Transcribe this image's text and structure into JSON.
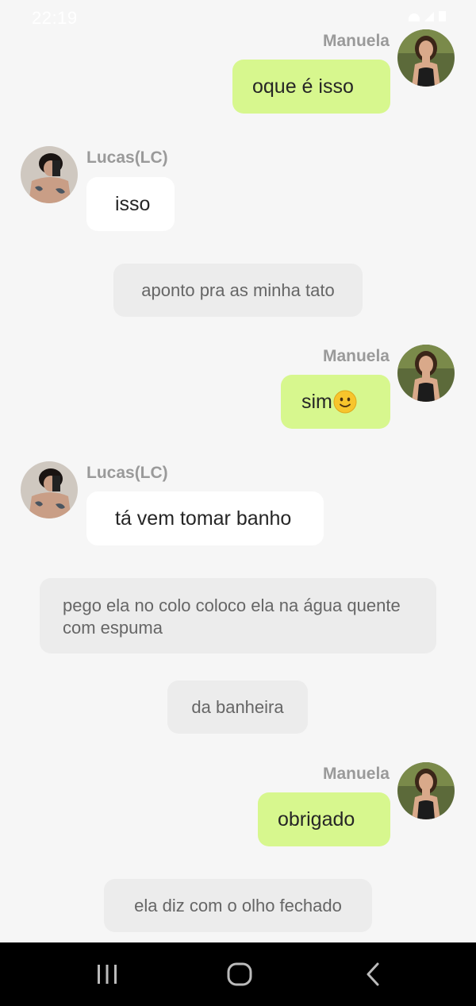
{
  "status_bar": {
    "time": "22:19"
  },
  "names": {
    "manuela": "Manuela",
    "lucas": "Lucas(LC)"
  },
  "messages": {
    "m1_text": "oque é isso",
    "m2_text": "isso",
    "n1_text": "aponto pra as minha tato",
    "m3_text": "sim",
    "m4_text": "tá vem tomar banho",
    "n2_text": "pego ela no colo coloco ela na água quente com espuma",
    "n3_text": "da banheira",
    "m5_text": "obrigado",
    "n4_text": "ela diz com o olho fechado"
  },
  "icons": {
    "smiley": "slightly-smiling-face-emoji",
    "nav_recents": "recent-apps-icon",
    "nav_home": "home-icon",
    "nav_back": "back-icon"
  },
  "colors": {
    "background": "#f6f6f6",
    "user_bubble": "#d7f78e",
    "character_bubble": "#ffffff",
    "narration_bubble": "#ececec",
    "name_text": "#9a9a9a",
    "nav_bar": "#000000"
  }
}
